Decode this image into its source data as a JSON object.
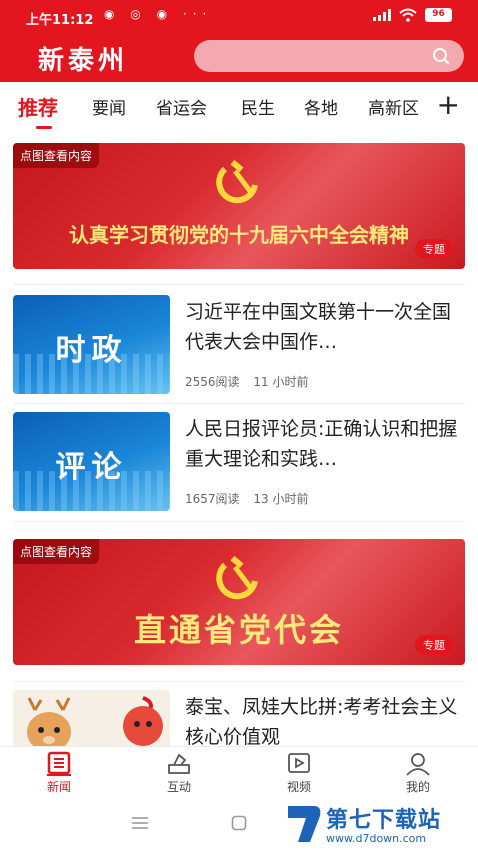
{
  "status_bar": {
    "time": "上午11:12",
    "notif_dots": "◉ ◎ ◉ ···",
    "battery": "96"
  },
  "header": {
    "logo": "新泰州",
    "search_placeholder": ""
  },
  "tabs": [
    {
      "label": "推荐",
      "active": true
    },
    {
      "label": "要闻"
    },
    {
      "label": "省运会"
    },
    {
      "label": "民生"
    },
    {
      "label": "各地"
    },
    {
      "label": "高新区"
    }
  ],
  "add_tab_icon": "plus-icon",
  "feed": {
    "banner1": {
      "tag": "点图查看内容",
      "title": "认真学习贯彻党的十九届六中全会精神",
      "badge": "专题"
    },
    "news1": {
      "thumb_text": "时政",
      "title": "习近平在中国文联第十一次全国代表大会中国作…",
      "reads": "2556阅读",
      "time": "11 小时前"
    },
    "news2": {
      "thumb_text": "评论",
      "title": "人民日报评论员:正确认识和把握重大理论和实践…",
      "reads": "1657阅读",
      "time": "13 小时前"
    },
    "banner2": {
      "tag": "点图查看内容",
      "title": "直通省党代会",
      "badge": "专题"
    },
    "news3": {
      "title": "泰宝、凤娃大比拼:考考社会主义核心价值观"
    }
  },
  "bottom_nav": [
    {
      "label": "新闻",
      "icon": "news-icon",
      "active": true
    },
    {
      "label": "互动",
      "icon": "interact-icon"
    },
    {
      "label": "视频",
      "icon": "video-icon"
    },
    {
      "label": "我的",
      "icon": "user-icon"
    }
  ],
  "watermark": {
    "title": "第七下载站",
    "url": "www.d7down.com"
  },
  "colors": {
    "brand_red": "#e3151f",
    "banner_gold": "#ffe97a",
    "watermark_blue": "#1d64b8"
  }
}
